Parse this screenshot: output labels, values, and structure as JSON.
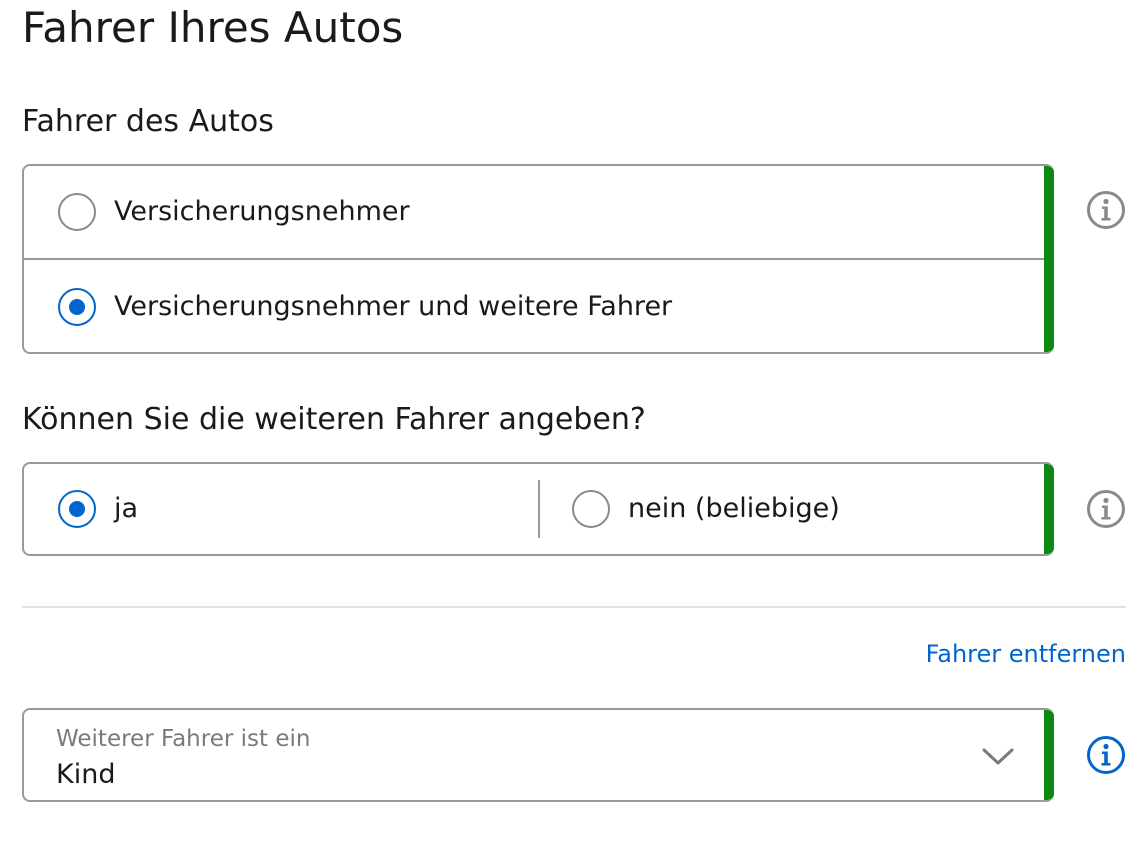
{
  "page": {
    "title": "Fahrer Ihres Autos"
  },
  "driver_section": {
    "label": "Fahrer des Autos",
    "options": [
      {
        "label": "Versicherungsnehmer",
        "checked": false
      },
      {
        "label": "Versicherungsnehmer und weitere Fahrer",
        "checked": true
      }
    ],
    "info_icon": "info-icon"
  },
  "more_drivers_section": {
    "label": "Können Sie die weiteren Fahrer angeben?",
    "options": [
      {
        "label": "ja",
        "checked": true
      },
      {
        "label": "nein (beliebige)",
        "checked": false
      }
    ],
    "info_icon": "info-icon"
  },
  "additional_driver": {
    "remove_link": "Fahrer entfernen",
    "select": {
      "label": "Weiterer Fahrer ist ein",
      "value": "Kind",
      "icon": "chevron-down-icon"
    },
    "info_icon": "info-icon"
  },
  "colors": {
    "accent_blue": "#0066cc",
    "valid_green": "#0a8a12",
    "border_gray": "#9b9b9b",
    "info_gray": "#8a8a8a"
  }
}
